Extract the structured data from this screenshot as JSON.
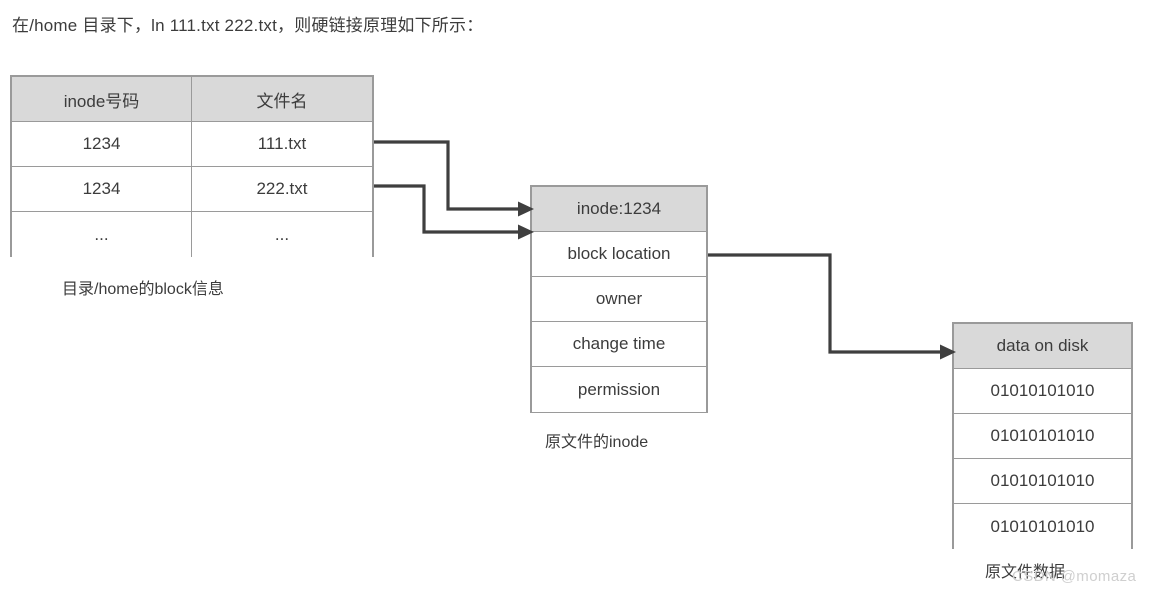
{
  "page": {
    "title": "在/home 目录下，ln 111.txt 222.txt，则硬链接原理如下所示："
  },
  "directory_table": {
    "name": "目录/home的block信息",
    "caption": "目录/home的block信息",
    "headers": [
      "inode号码",
      "文件名"
    ],
    "rows": [
      [
        "1234",
        "111.txt"
      ],
      [
        "1234",
        "222.txt"
      ],
      [
        "...",
        "..."
      ]
    ]
  },
  "inode_box": {
    "header": "inode:1234",
    "caption": "原文件的inode",
    "fields": [
      "block location",
      "owner",
      "change time",
      "permission"
    ]
  },
  "data_box": {
    "header": "data on disk",
    "caption": "原文件数据",
    "blocks": [
      "01010101010",
      "01010101010",
      "01010101010",
      "01010101010"
    ]
  },
  "watermark": {
    "text": "CSDN @momaza"
  },
  "colors": {
    "header_fill": "#d9d9d9",
    "box_border": "#9a9a9a",
    "arrow": "#3f3f3f",
    "text": "#3c3c3c",
    "background": "#ffffff"
  },
  "connectors": [
    {
      "from": "111.txt row",
      "to": "inode:1234 header",
      "style": "orthogonal-arrow"
    },
    {
      "from": "222.txt row",
      "to": "inode:1234 header",
      "style": "orthogonal-arrow"
    },
    {
      "from": "block location row",
      "to": "data on disk header",
      "style": "orthogonal-arrow"
    }
  ]
}
